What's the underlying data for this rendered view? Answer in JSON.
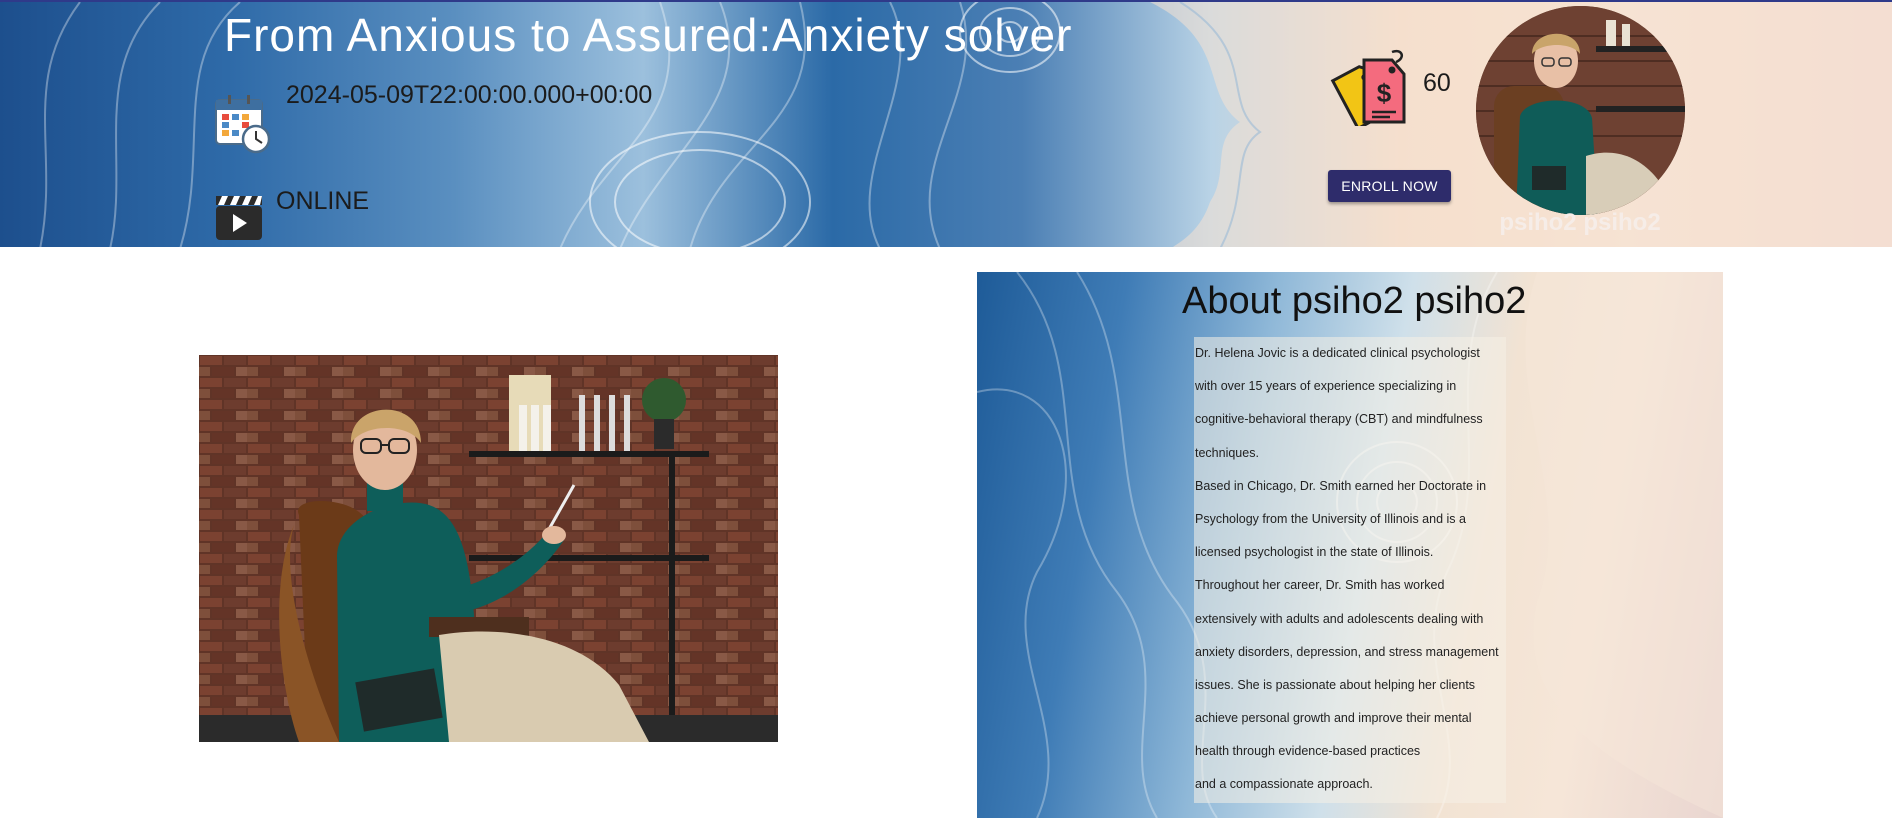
{
  "hero": {
    "title": "From Anxious to Assured:Anxiety solver",
    "date": "2024-05-09T22:00:00.000+00:00",
    "mode": "ONLINE",
    "price": "60",
    "enroll_label": "ENROLL NOW",
    "host_name": "psiho2 psiho2",
    "icons": {
      "date": "calendar-icon",
      "mode": "clapperboard-icon",
      "price": "price-tag-icon"
    }
  },
  "about": {
    "title": "About psiho2 psiho2",
    "lines": [
      "Dr. Helena Jovic is a dedicated clinical psychologist",
      "with over 15 years of experience specializing in",
      "cognitive-behavioral therapy (CBT) and mindfulness",
      "techniques.",
      "Based in Chicago, Dr. Smith earned her Doctorate in",
      "Psychology from the University of Illinois and is a",
      "licensed psychologist in the state of Illinois.",
      "Throughout her career, Dr. Smith has worked",
      "extensively with adults and adolescents dealing with",
      "anxiety disorders, depression, and stress management",
      "issues. She is passionate about helping her clients",
      "achieve personal growth and improve their mental",
      "health through evidence-based practices",
      "and a compassionate approach."
    ]
  },
  "colors": {
    "accent": "#2e2c6b",
    "banner_blue": "#2e6aa8",
    "banner_peach": "#f4dcc8"
  }
}
